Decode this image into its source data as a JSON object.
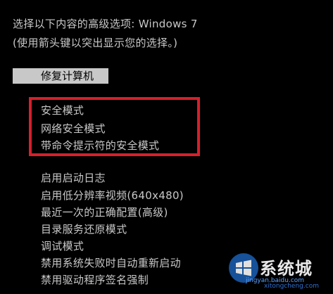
{
  "header": {
    "line1": "选择以下内容的高级选项: Windows 7",
    "line2": "(使用箭头键以突出显示您的选择。)"
  },
  "selected_item": "修复计算机",
  "safe_mode_options": [
    "安全模式",
    "网络安全模式",
    "带命令提示符的安全模式"
  ],
  "other_options": [
    "启用启动日志",
    "启用低分辨率视频(640x480)",
    "最近一次的正确配置(高级)",
    "目录服务还原模式",
    "调试模式",
    "禁用系统失败时自动重新启动",
    "禁用驱动程序签名强制"
  ],
  "colors": {
    "background": "#000000",
    "text": "#c8c8c8",
    "selection_bg": "#c8c8c8",
    "highlight_border": "#d6202b"
  },
  "watermark": {
    "brand": "系统城",
    "url": "jingyan.baidu.com",
    "url2": "xitongcheng.com",
    "icon": "windows-flag-icon"
  }
}
